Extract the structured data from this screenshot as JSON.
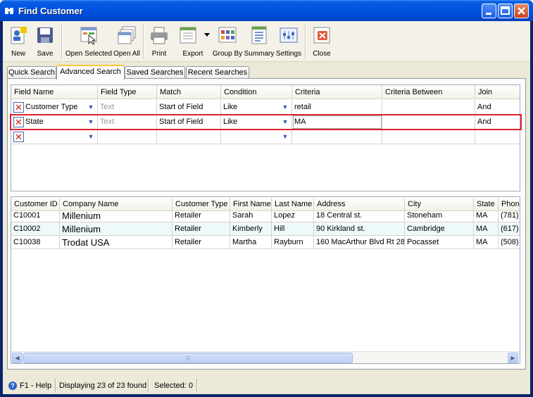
{
  "window": {
    "title": "Find Customer"
  },
  "toolbar": {
    "items": [
      {
        "label": "New",
        "icon": "new-customer-icon"
      },
      {
        "label": "Save",
        "icon": "floppy-disk-icon"
      },
      {
        "label": "Open Selected",
        "icon": "open-selected-icon"
      },
      {
        "label": "Open All",
        "icon": "open-all-icon"
      },
      {
        "label": "Print",
        "icon": "printer-icon"
      },
      {
        "label": "Export",
        "icon": "export-icon"
      },
      {
        "label": "Group By",
        "icon": "group-by-icon"
      },
      {
        "label": "Summary",
        "icon": "summary-icon"
      },
      {
        "label": "Settings",
        "icon": "settings-icon"
      },
      {
        "label": "Close",
        "icon": "close-doc-icon"
      }
    ]
  },
  "tabs": [
    "Quick Search",
    "Advanced Search",
    "Saved Searches",
    "Recent Searches"
  ],
  "criteria": {
    "columns": [
      "Field Name",
      "Field Type",
      "Match",
      "Condition",
      "Criteria",
      "Criteria Between",
      "Join"
    ],
    "rows": [
      {
        "field": "Customer Type",
        "type": "Text",
        "match": "Start of Field",
        "condition": "Like",
        "criteria": "retail",
        "between": "",
        "join": "And"
      },
      {
        "field": "State",
        "type": "Text",
        "match": "Start of Field",
        "condition": "Like",
        "criteria": "MA",
        "between": "",
        "join": "And"
      },
      {
        "field": "",
        "type": "",
        "match": "",
        "condition": "",
        "criteria": "",
        "between": "",
        "join": ""
      }
    ]
  },
  "results": {
    "columns": [
      "Customer ID",
      "Company Name",
      "Customer Type",
      "First Name",
      "Last Name",
      "Address",
      "City",
      "State",
      "Phone"
    ],
    "rows": [
      [
        "C10001",
        "Millenium",
        "Retailer",
        "Sarah",
        "Lopez",
        "18 Central st.",
        "Stoneham",
        "MA",
        "(781)"
      ],
      [
        "C10002",
        "Millenium",
        "Retailer",
        "Kimberly",
        "Hill",
        "90 Kirkland st.",
        "Cambridge",
        "MA",
        "(617)"
      ],
      [
        "C10038",
        "Trodat USA",
        "Retailer",
        "Martha",
        "Rayburn",
        "160 MacArthur Blvd Rt 28",
        "Pocasset",
        "MA",
        "(508)"
      ]
    ]
  },
  "status": {
    "help": "F1 - Help",
    "found": "Displaying 23 of 23 found",
    "selected": "Selected: 0"
  }
}
